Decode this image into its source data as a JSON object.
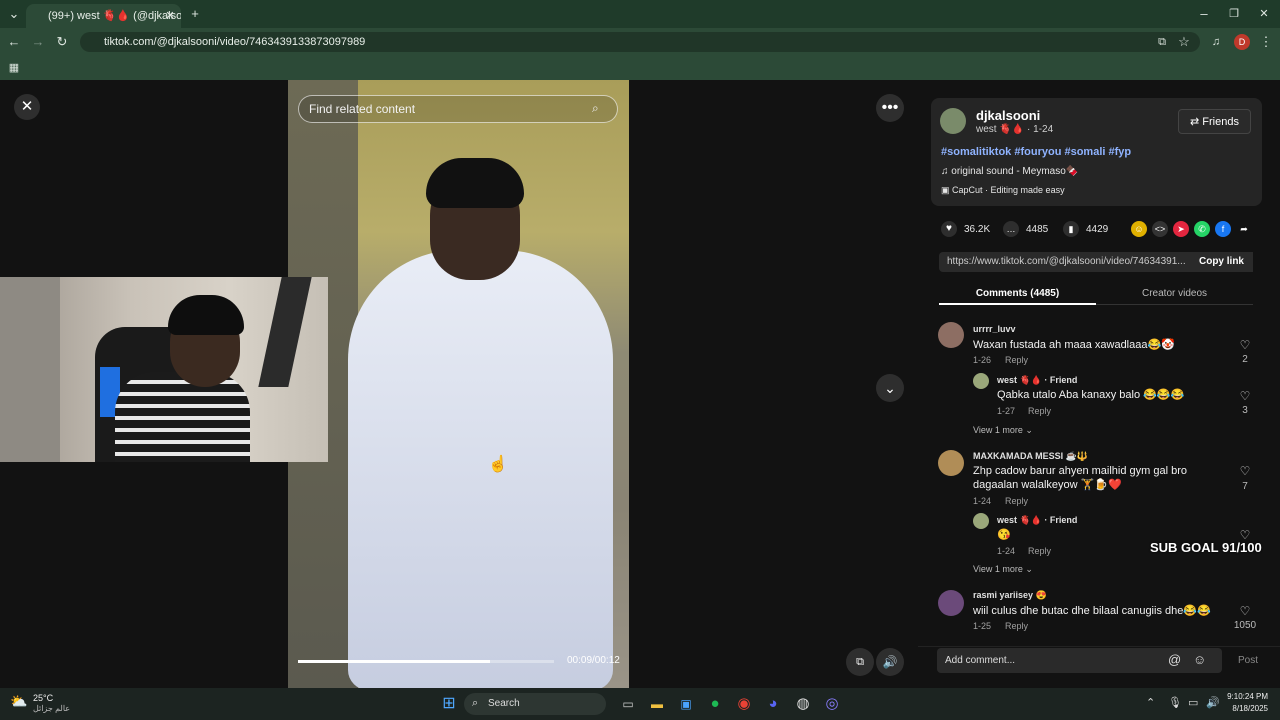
{
  "browser": {
    "tab_title": "(99+) west 🫀🩸 (@djkalso",
    "url": "tiktok.com/@djkalsooni/video/7463439133873097989",
    "profile_initial": "D"
  },
  "video": {
    "search_placeholder": "Find related content",
    "time": "00:09/00:12",
    "progress": 0.75
  },
  "author": {
    "name": "djkalsooni",
    "subtitle": "west 🫀🩸 · 1-24",
    "friends_label": "Friends",
    "hashtags": "#somalitiktok #fouryou #somali #fyp",
    "sound": "original sound - Meymaso🍫",
    "capcut": "CapCut · Editing made easy"
  },
  "stats": {
    "likes": "36.2K",
    "comments": "4485",
    "saves": "4429"
  },
  "link": {
    "url": "https://www.tiktok.com/@djkalsooni/video/74634391...",
    "copy_label": "Copy link"
  },
  "tabs": {
    "comments": "Comments (4485)",
    "creator": "Creator videos"
  },
  "comments": [
    {
      "user": "urrrr_luvv",
      "text": "Waxan fustada ah maaa xawadlaaa😂🤡",
      "date": "1-26",
      "reply": "Reply",
      "likes": "2"
    },
    {
      "user": "west 🫀🩸 · Friend",
      "text": "Qabka utalo Aba kanaxy balo 😂😂😂",
      "date": "1-27",
      "reply": "Reply",
      "likes": "3"
    },
    {
      "user": "MAXKAMADA MESSI ☕🔱",
      "text": "Zhp cadow barur ahyen mailhid gym gal bro dagaalan walalkeyow 🏋🍺❤️",
      "date": "1-24",
      "reply": "Reply",
      "likes": "7"
    },
    {
      "user": "west 🫀🩸 · Friend",
      "text": "😘",
      "date": "1-24",
      "reply": "Reply",
      "likes": ""
    },
    {
      "user": "rasmi yariisey 😍",
      "text": "wiil culus dhe butac dhe bilaal canugiis dhe😂😂",
      "date": "1-25",
      "reply": "Reply",
      "likes": "1050"
    }
  ],
  "view_more": "View 1 more",
  "overlay": {
    "subgoal": "SUB GOAL 91/100"
  },
  "add_comment": {
    "placeholder": "Add comment...",
    "post": "Post"
  },
  "taskbar": {
    "weather_temp": "25°C",
    "weather_text": "عالم جزائل",
    "search": "Search",
    "time": "9:10:24 PM",
    "date": "8/18/2025"
  }
}
